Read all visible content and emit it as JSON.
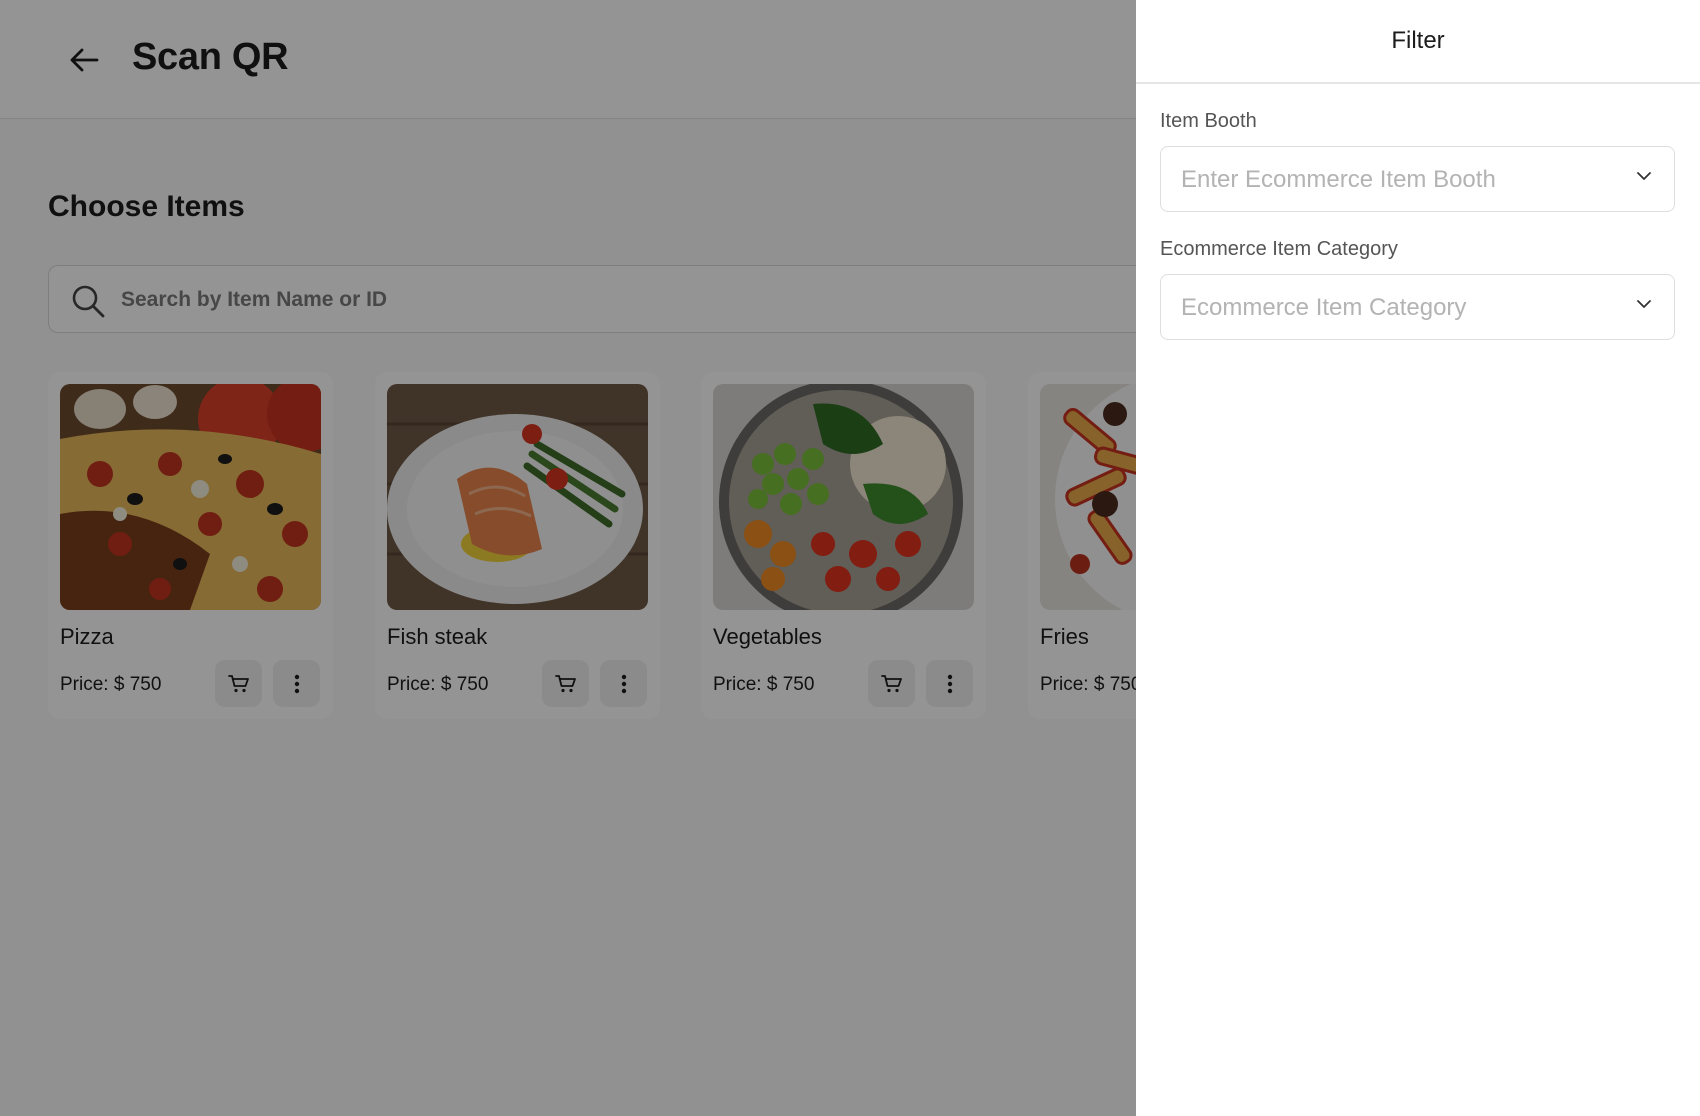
{
  "header": {
    "title": "Scan QR"
  },
  "main": {
    "section_title": "Choose Items",
    "search": {
      "placeholder": "Search by Item Name or ID"
    },
    "items": [
      {
        "name": "Pizza",
        "price": "Price: $ 750"
      },
      {
        "name": "Fish steak",
        "price": "Price: $ 750"
      },
      {
        "name": "Vegetables",
        "price": "Price: $ 750"
      },
      {
        "name": "Fries",
        "price": "Price: $ 750"
      }
    ]
  },
  "filter": {
    "title": "Filter",
    "booth": {
      "label": "Item Booth",
      "placeholder": "Enter Ecommerce Item Booth"
    },
    "category": {
      "label": "Ecommerce Item Category",
      "placeholder": "Ecommerce Item Category"
    }
  },
  "icons": {
    "back": "arrow-left-icon",
    "search": "search-icon",
    "cart": "cart-icon",
    "more": "more-vertical-icon",
    "dropdown": "chevron-down-icon"
  },
  "colors": {
    "overlay": "#00000069",
    "drawer_bg": "#ffffff",
    "text": "#1c1c1c",
    "placeholder": "#b3b3b3"
  }
}
